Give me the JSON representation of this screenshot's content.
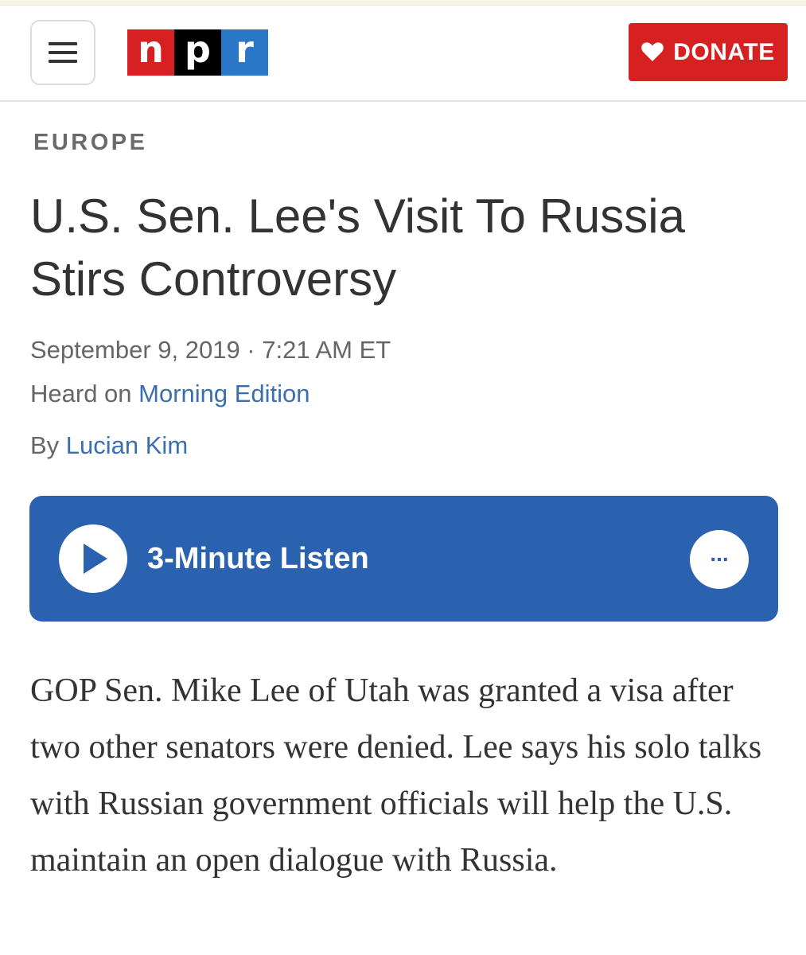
{
  "header": {
    "logo": {
      "letters": [
        "n",
        "p",
        "r"
      ],
      "colors": [
        "#d62021",
        "#000000",
        "#2a77c8"
      ]
    },
    "menu_icon": "hamburger-menu-icon",
    "donate": {
      "label": "DONATE",
      "icon": "heart-icon",
      "color": "#d62021"
    }
  },
  "article": {
    "section": "EUROPE",
    "headline": "U.S. Sen. Lee's Visit To Russia Stirs Controversy",
    "date": "September 9, 2019 · 7:21 AM ET",
    "heard_on_prefix": "Heard on ",
    "heard_on_program": "Morning Edition",
    "byline_prefix": "By ",
    "author": "Lucian Kim",
    "teaser": "GOP Sen. Mike Lee of Utah was granted a visa after two other senators were denied. Lee says his solo talks with Russian government officials will help the U.S. maintain an open dialogue with Russia."
  },
  "player": {
    "label": "3-Minute Listen",
    "play_icon": "play-icon",
    "more_label": "...",
    "more_icon": "more-options-icon",
    "color": "#2b62b0"
  },
  "colors": {
    "link": "#3a6eb0",
    "text": "#333333",
    "meta": "#666666"
  }
}
